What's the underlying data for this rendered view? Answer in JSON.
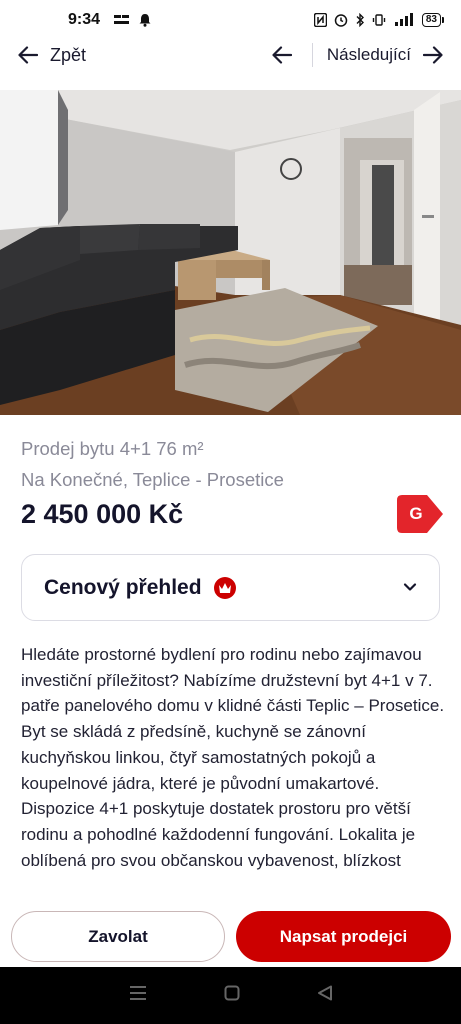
{
  "status_bar": {
    "time": "9:34",
    "battery": "83",
    "icons": [
      "notification-icon",
      "bell-icon",
      "nfc-icon",
      "alarm-icon",
      "bluetooth-icon",
      "vibrate-icon",
      "signal-icon"
    ]
  },
  "nav": {
    "back_label": "Zpět",
    "next_label": "Následující"
  },
  "gallery": {
    "total_images": 3,
    "active_index": 0
  },
  "listing": {
    "title": "Prodej bytu 4+1 76 m²",
    "location": "Na Konečné, Teplice - Prosetice",
    "price": "2 450 000 Kč",
    "energy_class": "G"
  },
  "price_overview": {
    "title": "Cenový přehled"
  },
  "description": "Hledáte prostorné bydlení pro rodinu nebo zajímavou investiční příležitost? Nabízíme družstevní byt 4+1 v 7. patře panelového domu v klidné části Teplic – Prosetice. Byt se skládá z předsíně, kuchyně se zánovní kuchyňskou linkou, čtyř samostatných pokojů a koupelnové jádra, které je původní umakartové.  Dispozice 4+1 poskytuje dostatek prostoru pro větší rodinu a pohodlné každodenní fungování. Lokalita je oblíbená pro svou občanskou vybavenost, blízkost",
  "actions": {
    "call_label": "Zavolat",
    "message_label": "Napsat prodejci"
  },
  "colors": {
    "accent": "#cc0000",
    "text_primary": "#14142b",
    "text_muted": "#8a8a98"
  }
}
